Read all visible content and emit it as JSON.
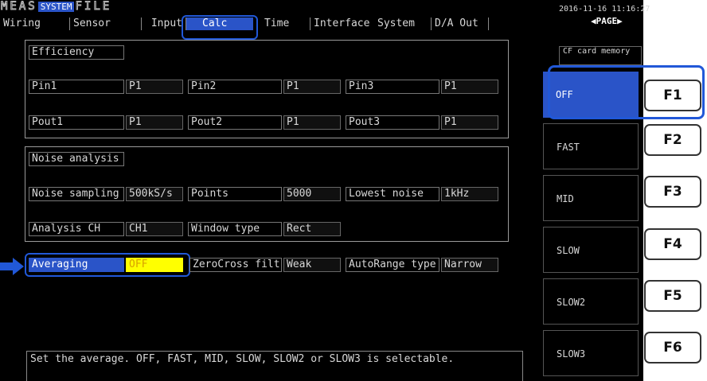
{
  "header": {
    "modes": [
      {
        "label": "MEAS",
        "active": false
      },
      {
        "label": "SYSTEM",
        "active": true
      },
      {
        "label": "FILE",
        "active": false
      }
    ],
    "datetime": "2016-11-16 11:16:27",
    "page_key": "PAGE"
  },
  "tabs": [
    {
      "label": "Wiring",
      "selected": false
    },
    {
      "label": "Sensor",
      "selected": false
    },
    {
      "label": "Input",
      "selected": false
    },
    {
      "label": "Calc",
      "selected": true
    },
    {
      "label": "Time",
      "selected": false
    },
    {
      "label": "Interface",
      "selected": false
    },
    {
      "label": "System",
      "selected": false
    },
    {
      "label": "D/A Out",
      "selected": false
    }
  ],
  "efficiency": {
    "title": "Efficiency",
    "pin1_label": "Pin1",
    "pin1_value": "P1",
    "pin2_label": "Pin2",
    "pin2_value": "P1",
    "pin3_label": "Pin3",
    "pin3_value": "P1",
    "pout1_label": "Pout1",
    "pout1_value": "P1",
    "pout2_label": "Pout2",
    "pout2_value": "P1",
    "pout3_label": "Pout3",
    "pout3_value": "P1"
  },
  "noise": {
    "title": "Noise analysis",
    "sampling_label": "Noise sampling",
    "sampling_value": "500kS/s",
    "points_label": "Points",
    "points_value": "5000",
    "lowest_label": "Lowest noise",
    "lowest_value": "1kHz",
    "ch_label": "Analysis CH",
    "ch_value": "CH1",
    "window_label": "Window type",
    "window_value": "Rect"
  },
  "averaging": {
    "label": "Averaging",
    "value": "OFF"
  },
  "zerocross": {
    "label": "ZeroCross filt",
    "value": "Weak"
  },
  "autorange": {
    "label": "AutoRange type",
    "value": "Narrow"
  },
  "message": "Set the average. OFF, FAST, MID, SLOW, SLOW2 or SLOW3 is selectable.",
  "cf_card": "CF card memory",
  "function_keys": [
    {
      "option": "OFF",
      "key": "F1",
      "selected": true
    },
    {
      "option": "FAST",
      "key": "F2",
      "selected": false
    },
    {
      "option": "MID",
      "key": "F3",
      "selected": false
    },
    {
      "option": "SLOW",
      "key": "F4",
      "selected": false
    },
    {
      "option": "SLOW2",
      "key": "F5",
      "selected": false
    },
    {
      "option": "SLOW3",
      "key": "F6",
      "selected": false
    }
  ],
  "colors": {
    "highlight": "#2158d8",
    "selected_bg": "#2a54c8",
    "active_value_bg": "#ffff00",
    "active_value_text": "#d8a000"
  }
}
